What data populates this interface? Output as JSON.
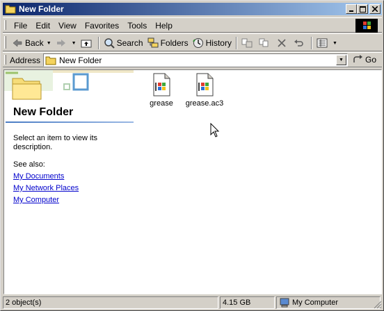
{
  "window": {
    "title": "New Folder"
  },
  "titlebar": {
    "minimize": "_",
    "maximize": "□",
    "close": "×"
  },
  "menu": [
    "File",
    "Edit",
    "View",
    "Favorites",
    "Tools",
    "Help"
  ],
  "toolbar": {
    "back": "Back",
    "search": "Search",
    "folders": "Folders",
    "history": "History"
  },
  "address": {
    "label": "Address",
    "value": "New Folder",
    "go": "Go"
  },
  "panel": {
    "title": "New Folder",
    "description": "Select an item to view its description.",
    "see_also": "See also:",
    "links": [
      "My Documents",
      "My Network Places",
      "My Computer"
    ]
  },
  "files": [
    {
      "name": "grease",
      "icon": "media-file-icon"
    },
    {
      "name": "grease.ac3",
      "icon": "media-file-icon"
    }
  ],
  "status": {
    "objects": "2 object(s)",
    "size": "4.15 GB",
    "location": "My Computer"
  },
  "colors": {
    "title_start": "#0a246a",
    "title_end": "#a6caf0",
    "face": "#d4d0c8",
    "link": "#0000cc"
  }
}
